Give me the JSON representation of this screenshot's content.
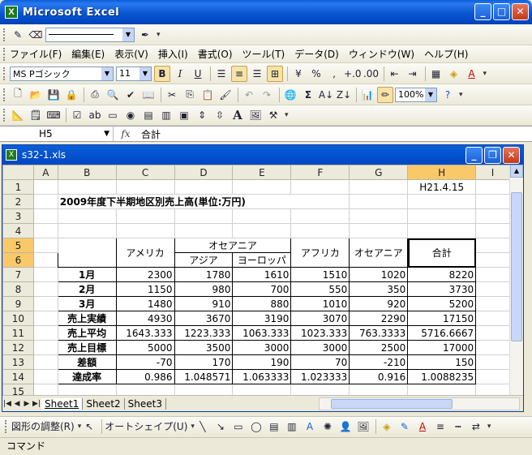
{
  "window": {
    "title": "Microsoft Excel",
    "app_icon": "X"
  },
  "menu": {
    "items": [
      "ファイル(F)",
      "編集(E)",
      "表示(V)",
      "挿入(I)",
      "書式(O)",
      "ツール(T)",
      "データ(D)",
      "ウィンドウ(W)",
      "ヘルプ(H)"
    ]
  },
  "format_toolbar": {
    "font_name": "MS Pゴシック",
    "font_size": "11",
    "bold": "B",
    "italic": "I",
    "underline": "U",
    "percent": "%",
    "comma": ","
  },
  "standard_toolbar": {
    "zoom": "100%",
    "sigma": "Σ"
  },
  "formula_bar": {
    "name_box": "H5",
    "fx": "fx",
    "content": "合計"
  },
  "workbook": {
    "title": "s32-1.xls",
    "icon": "X"
  },
  "columns": [
    "",
    "A",
    "B",
    "C",
    "D",
    "E",
    "F",
    "G",
    "H",
    "I"
  ],
  "rows": [
    "1",
    "2",
    "3",
    "4",
    "5",
    "6",
    "7",
    "8",
    "9",
    "10",
    "11",
    "12",
    "13",
    "14",
    "15"
  ],
  "sheet": {
    "date": "H21.4.15",
    "title": "2009年度下半期地区別売上高(単位:万円)",
    "headers": {
      "america": "アメリカ",
      "oceania_group": "オセアニア",
      "asia": "アジア",
      "europe": "ヨーロッパ",
      "africa": "アフリカ",
      "oceania": "オセアニア",
      "total": "合計"
    },
    "data_rows": [
      {
        "label": "1月",
        "values": [
          "2300",
          "1780",
          "1610",
          "1510",
          "1020",
          "8220"
        ]
      },
      {
        "label": "2月",
        "values": [
          "1150",
          "980",
          "700",
          "550",
          "350",
          "3730"
        ]
      },
      {
        "label": "3月",
        "values": [
          "1480",
          "910",
          "880",
          "1010",
          "920",
          "5200"
        ]
      },
      {
        "label": "売上実績",
        "values": [
          "4930",
          "3670",
          "3190",
          "3070",
          "2290",
          "17150"
        ]
      },
      {
        "label": "売上平均",
        "values": [
          "1643.333",
          "1223.333",
          "1063.333",
          "1023.333",
          "763.3333",
          "5716.6667"
        ]
      },
      {
        "label": "売上目標",
        "values": [
          "5000",
          "3500",
          "3000",
          "3000",
          "2500",
          "17000"
        ]
      },
      {
        "label": "差額",
        "values": [
          "-70",
          "170",
          "190",
          "70",
          "-210",
          "150"
        ]
      },
      {
        "label": "達成率",
        "values": [
          "0.986",
          "1.048571",
          "1.063333",
          "1.023333",
          "0.916",
          "1.0088235"
        ]
      }
    ]
  },
  "sheet_tabs": [
    "Sheet1",
    "Sheet2",
    "Sheet3"
  ],
  "draw_toolbar": {
    "adjust": "図形の調整(R)",
    "autoshape": "オートシェイプ(U)"
  },
  "status": {
    "text": "コマンド"
  },
  "colors": {
    "titlebar": "#0a56d0",
    "selected_header": "#f9c969",
    "header_bg": "#eceadb"
  }
}
